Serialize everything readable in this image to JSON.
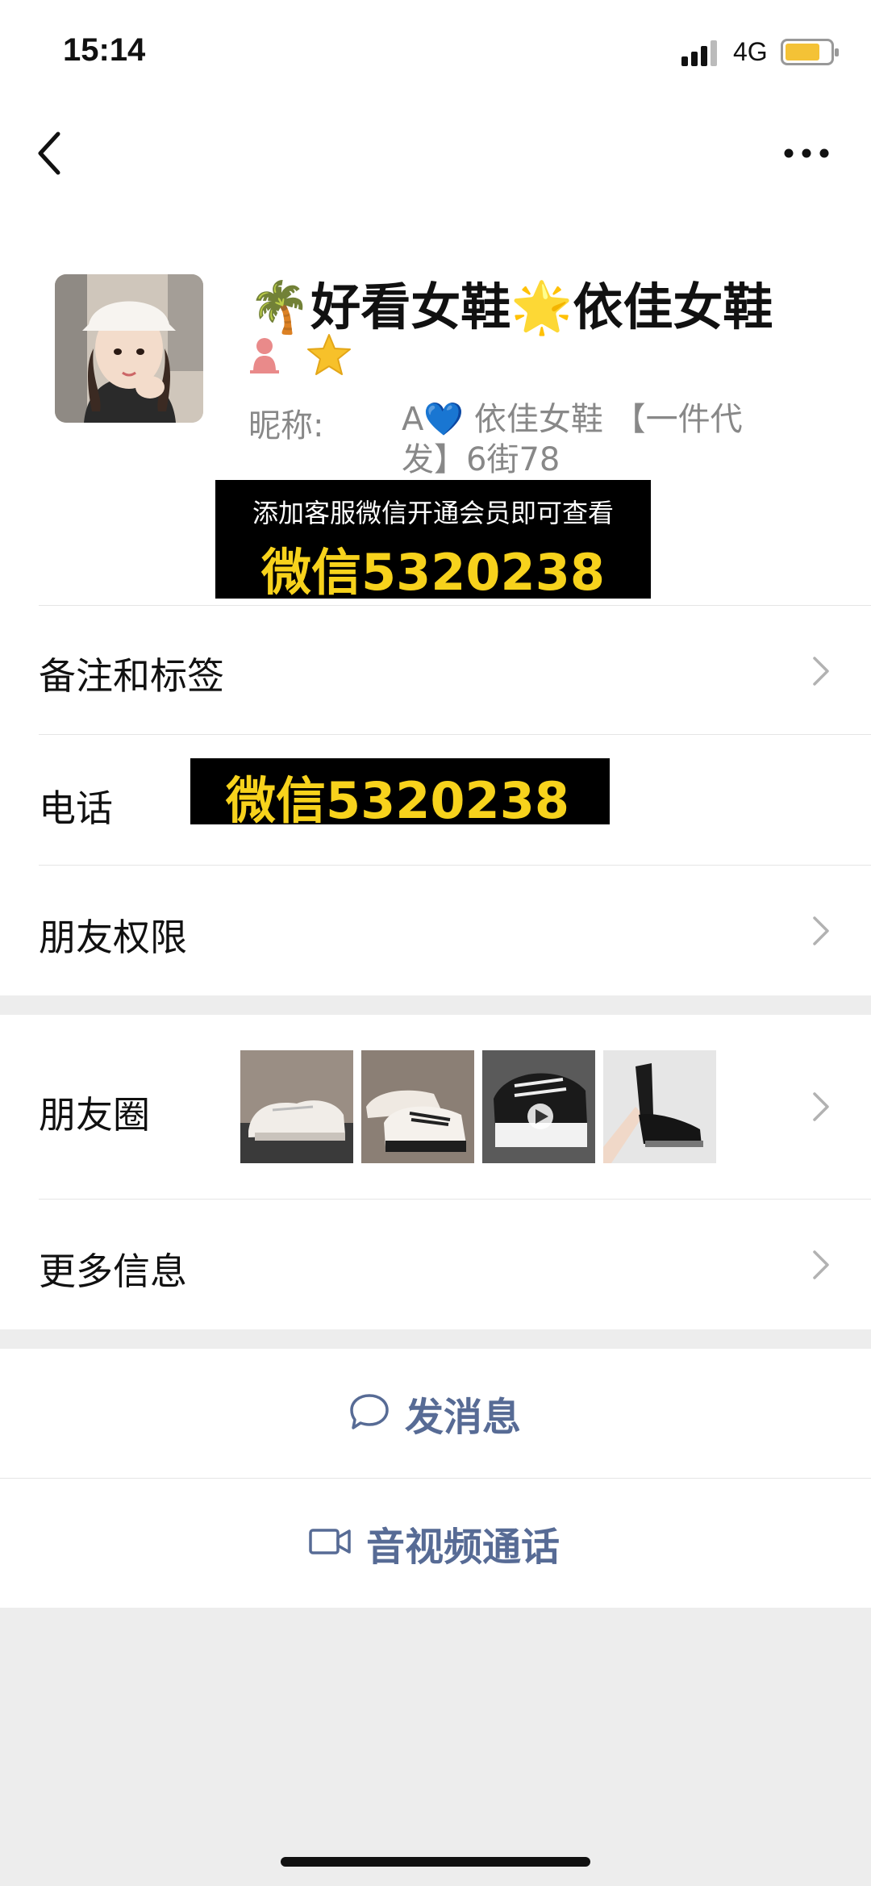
{
  "status": {
    "time": "15:14",
    "network": "4G"
  },
  "nav": {
    "back": "back",
    "more": "more"
  },
  "profile": {
    "name": "🌴好看女鞋🌟依佳女鞋",
    "nickname_label": "昵称:",
    "nickname_value": "A💙 依佳女鞋 【一件代发】6街78",
    "promo_small": "添加客服微信开通会员即可查看",
    "promo_big": "微信5320238"
  },
  "rows": {
    "remark": "备注和标签",
    "phone": "电话",
    "phone_value": "微信5320238",
    "friend_perm": "朋友权限",
    "moments": "朋友圈",
    "more_info": "更多信息"
  },
  "actions": {
    "message": "发消息",
    "call": "音视频通话"
  },
  "colors": {
    "link": "#576b95",
    "promo_yellow": "#f7d21c",
    "background": "#ededed"
  },
  "icons": [
    "signal-icon",
    "battery-icon",
    "back-icon",
    "more-icon",
    "gender-female-icon",
    "star-icon",
    "chevron-right-icon",
    "chat-bubble-icon",
    "video-call-icon"
  ]
}
